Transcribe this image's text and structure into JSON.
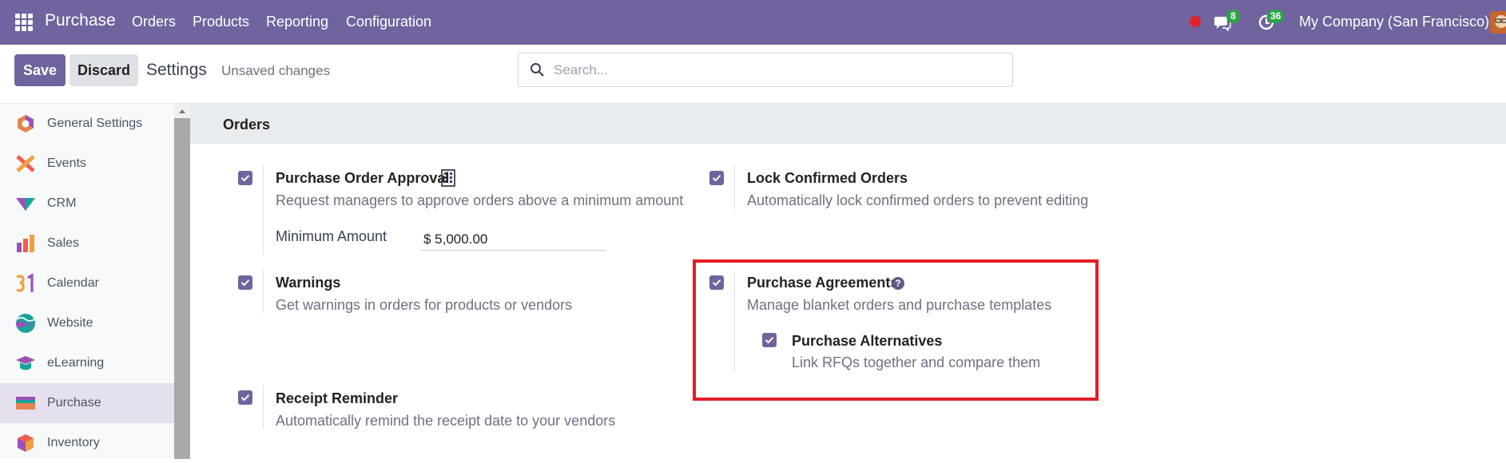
{
  "navbar": {
    "app_name": "Purchase",
    "menu": [
      "Orders",
      "Products",
      "Reporting",
      "Configuration"
    ],
    "chat_badge": "8",
    "activity_badge": "36",
    "company": "My Company (San Francisco)"
  },
  "control_panel": {
    "save_label": "Save",
    "discard_label": "Discard",
    "title": "Settings",
    "status": "Unsaved changes",
    "search_placeholder": "Search..."
  },
  "sidebar": {
    "items": [
      {
        "label": "General Settings",
        "icon": "general-settings-icon"
      },
      {
        "label": "Events",
        "icon": "events-icon"
      },
      {
        "label": "CRM",
        "icon": "crm-icon"
      },
      {
        "label": "Sales",
        "icon": "sales-icon"
      },
      {
        "label": "Calendar",
        "icon": "calendar-icon"
      },
      {
        "label": "Website",
        "icon": "website-icon"
      },
      {
        "label": "eLearning",
        "icon": "elearning-icon"
      },
      {
        "label": "Purchase",
        "icon": "purchase-icon",
        "active": true
      },
      {
        "label": "Inventory",
        "icon": "inventory-icon"
      }
    ]
  },
  "section": {
    "title": "Orders",
    "options": {
      "po_approval": {
        "title": "Purchase Order Approval",
        "desc": "Request managers to approve orders above a minimum amount",
        "checked": true,
        "field_label": "Minimum Amount",
        "field_value": "$ 5,000.00"
      },
      "lock_orders": {
        "title": "Lock Confirmed Orders",
        "desc": "Automatically lock confirmed orders to prevent editing",
        "checked": true
      },
      "warnings": {
        "title": "Warnings",
        "desc": "Get warnings in orders for products or vendors",
        "checked": true
      },
      "agreements": {
        "title": "Purchase Agreements",
        "desc": "Manage blanket orders and purchase templates",
        "checked": true,
        "help_glyph": "?"
      },
      "alternatives": {
        "title": "Purchase Alternatives",
        "desc": "Link RFQs together and compare them",
        "checked": true
      },
      "receipt_reminder": {
        "title": "Receipt Reminder",
        "desc": "Automatically remind the receipt date to your vendors",
        "checked": true
      }
    }
  },
  "colors": {
    "brand": "#71639e",
    "highlight": "#e41e26",
    "badge": "#28a745"
  }
}
